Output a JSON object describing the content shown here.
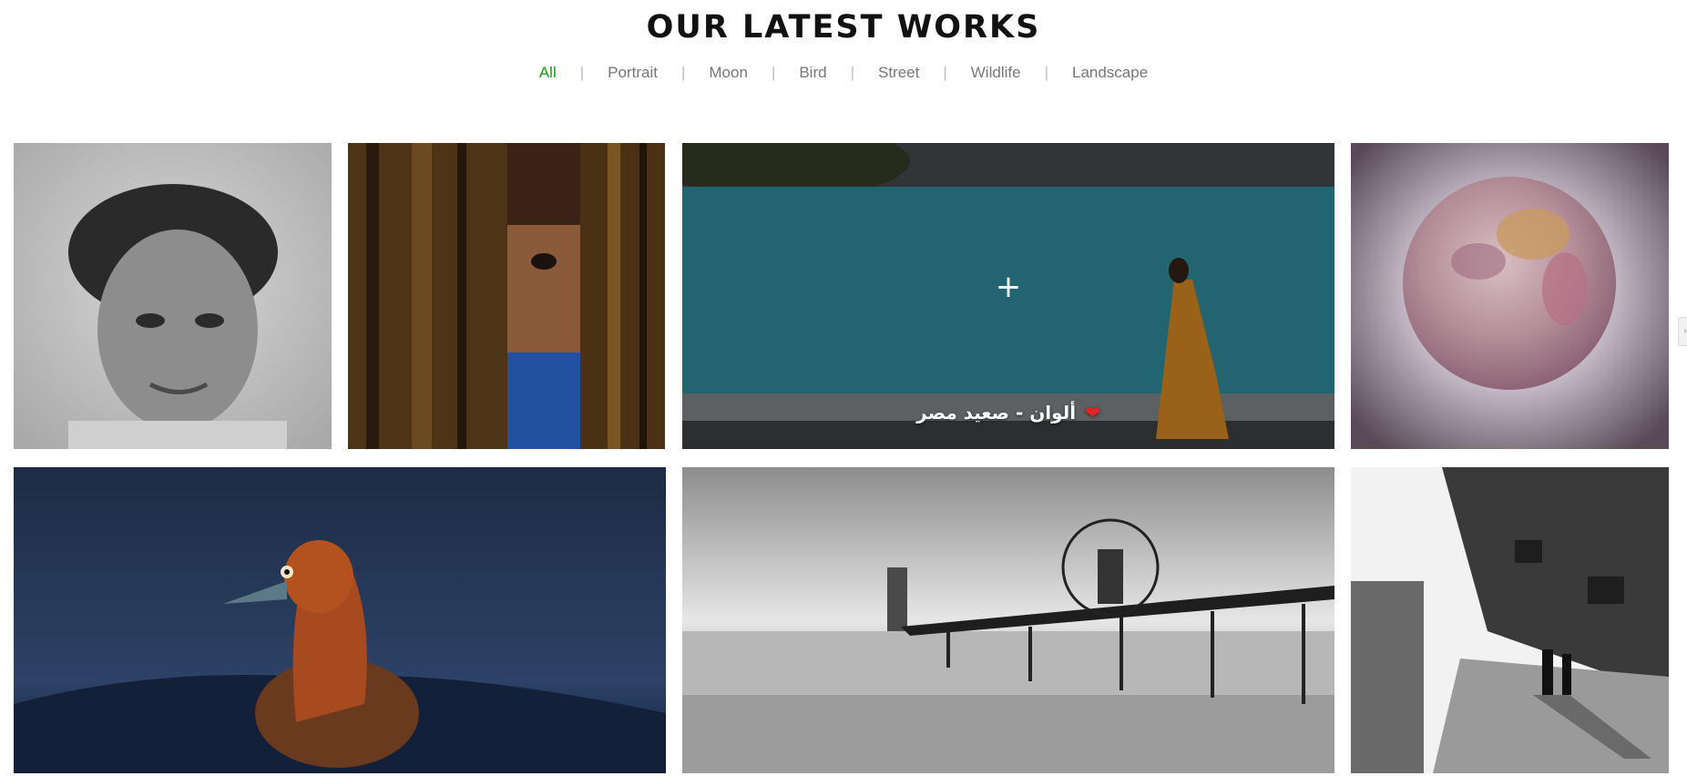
{
  "section": {
    "title": "OUR LATEST WORKS"
  },
  "filters": [
    "All",
    "Portrait",
    "Moon",
    "Bird",
    "Street",
    "Wildlife",
    "Landscape"
  ],
  "filter_separator": "|",
  "active_filter": "All",
  "accent_color": "#1a9a1a",
  "hover_tile": {
    "icon": "+",
    "caption": "ألوان - صعيد مصر",
    "heart": "❤"
  },
  "edge_tab": {
    "icon": "›"
  }
}
